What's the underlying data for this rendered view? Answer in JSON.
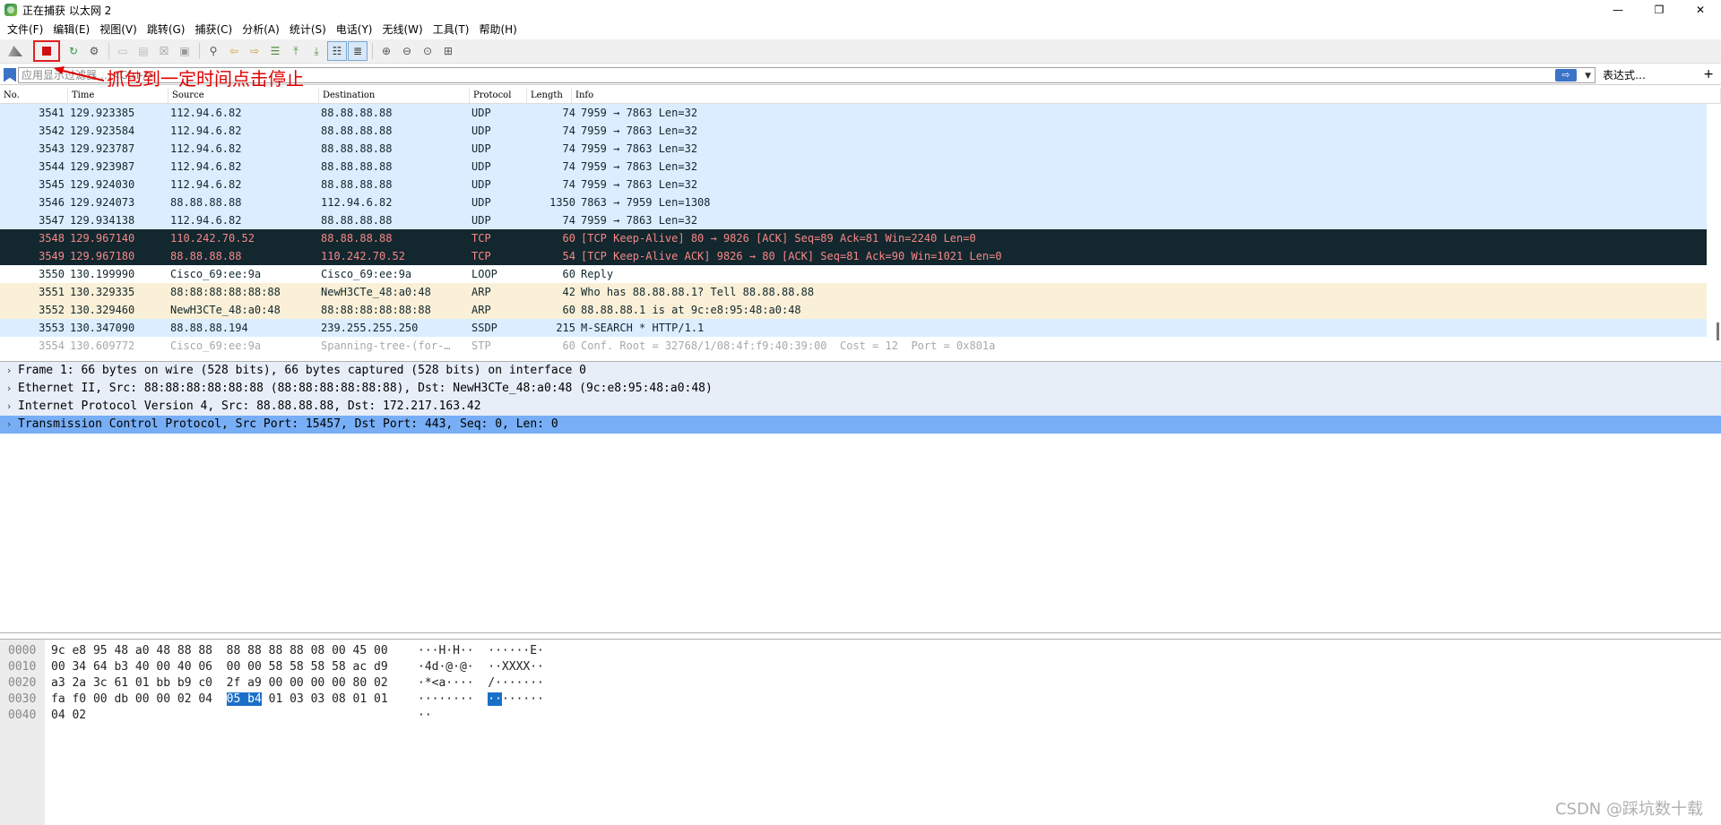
{
  "window": {
    "title": "正在捕获 以太网 2",
    "minimize": "—",
    "restore": "❐",
    "close": "✕"
  },
  "menu": [
    "文件(F)",
    "编辑(E)",
    "视图(V)",
    "跳转(G)",
    "捕获(C)",
    "分析(A)",
    "统计(S)",
    "电话(Y)",
    "无线(W)",
    "工具(T)",
    "帮助(H)"
  ],
  "annotation": {
    "text": "抓包到一定时间点击停止",
    "color": "#e00000"
  },
  "filter": {
    "placeholder": "应用显示过滤器 …<Ctrl-/>",
    "expression_label": "表达式…",
    "apply_icon": "⇨",
    "plus": "+"
  },
  "packet_list": {
    "columns": [
      "No.",
      "Time",
      "Source",
      "Destination",
      "Protocol",
      "Length",
      "Info"
    ],
    "rows": [
      {
        "no": "3541",
        "time": "129.923385",
        "src": "112.94.6.82",
        "dst": "88.88.88.88",
        "proto": "UDP",
        "len": "74",
        "info": "7959 → 7863 Len=32",
        "style": "bg-udp"
      },
      {
        "no": "3542",
        "time": "129.923584",
        "src": "112.94.6.82",
        "dst": "88.88.88.88",
        "proto": "UDP",
        "len": "74",
        "info": "7959 → 7863 Len=32",
        "style": "bg-udp"
      },
      {
        "no": "3543",
        "time": "129.923787",
        "src": "112.94.6.82",
        "dst": "88.88.88.88",
        "proto": "UDP",
        "len": "74",
        "info": "7959 → 7863 Len=32",
        "style": "bg-udp"
      },
      {
        "no": "3544",
        "time": "129.923987",
        "src": "112.94.6.82",
        "dst": "88.88.88.88",
        "proto": "UDP",
        "len": "74",
        "info": "7959 → 7863 Len=32",
        "style": "bg-udp"
      },
      {
        "no": "3545",
        "time": "129.924030",
        "src": "112.94.6.82",
        "dst": "88.88.88.88",
        "proto": "UDP",
        "len": "74",
        "info": "7959 → 7863 Len=32",
        "style": "bg-udp"
      },
      {
        "no": "3546",
        "time": "129.924073",
        "src": "88.88.88.88",
        "dst": "112.94.6.82",
        "proto": "UDP",
        "len": "1350",
        "info": "7863 → 7959 Len=1308",
        "style": "bg-udp"
      },
      {
        "no": "3547",
        "time": "129.934138",
        "src": "112.94.6.82",
        "dst": "88.88.88.88",
        "proto": "UDP",
        "len": "74",
        "info": "7959 → 7863 Len=32",
        "style": "bg-udp"
      },
      {
        "no": "3548",
        "time": "129.967140",
        "src": "110.242.70.52",
        "dst": "88.88.88.88",
        "proto": "TCP",
        "len": "60",
        "info": "[TCP Keep-Alive] 80 → 9826 [ACK] Seq=89 Ack=81 Win=2240 Len=0",
        "style": "bg-tcperr"
      },
      {
        "no": "3549",
        "time": "129.967180",
        "src": "88.88.88.88",
        "dst": "110.242.70.52",
        "proto": "TCP",
        "len": "54",
        "info": "[TCP Keep-Alive ACK] 9826 → 80 [ACK] Seq=81 Ack=90 Win=1021 Len=0",
        "style": "bg-tcperr"
      },
      {
        "no": "3550",
        "time": "130.199990",
        "src": "Cisco_69:ee:9a",
        "dst": "Cisco_69:ee:9a",
        "proto": "LOOP",
        "len": "60",
        "info": "Reply",
        "style": "bg-white"
      },
      {
        "no": "3551",
        "time": "130.329335",
        "src": "88:88:88:88:88:88",
        "dst": "NewH3CTe_48:a0:48",
        "proto": "ARP",
        "len": "42",
        "info": "Who has 88.88.88.1? Tell 88.88.88.88",
        "style": "bg-arp"
      },
      {
        "no": "3552",
        "time": "130.329460",
        "src": "NewH3CTe_48:a0:48",
        "dst": "88:88:88:88:88:88",
        "proto": "ARP",
        "len": "60",
        "info": "88.88.88.1 is at 9c:e8:95:48:a0:48",
        "style": "bg-arp"
      },
      {
        "no": "3553",
        "time": "130.347090",
        "src": "88.88.88.194",
        "dst": "239.255.255.250",
        "proto": "SSDP",
        "len": "215",
        "info": "M-SEARCH * HTTP/1.1",
        "style": "bg-ssdp"
      },
      {
        "no": "3554",
        "time": "130.609772",
        "src": "Cisco_69:ee:9a",
        "dst": "Spanning-tree-(for-…",
        "proto": "STP",
        "len": "60",
        "info": "Conf. Root = 32768/1/08:4f:f9:40:39:00  Cost = 12  Port = 0x801a",
        "style": "bg-stp"
      }
    ]
  },
  "details": [
    {
      "text": "Frame 1: 66 bytes on wire (528 bits), 66 bytes captured (528 bits) on interface 0",
      "selected": false
    },
    {
      "text": "Ethernet II, Src: 88:88:88:88:88:88 (88:88:88:88:88:88), Dst: NewH3CTe_48:a0:48 (9c:e8:95:48:a0:48)",
      "selected": false
    },
    {
      "text": "Internet Protocol Version 4, Src: 88.88.88.88, Dst: 172.217.163.42",
      "selected": false
    },
    {
      "text": "Transmission Control Protocol, Src Port: 15457, Dst Port: 443, Seq: 0, Len: 0",
      "selected": true
    }
  ],
  "bytes": [
    {
      "offset": "0000",
      "hex": "9c e8 95 48 a0 48 88 88  88 88 88 88 08 00 45 00",
      "ascii": "···H·H··  ······E·"
    },
    {
      "offset": "0010",
      "hex": "00 34 64 b3 40 00 40 06  00 00 58 58 58 58 ac d9",
      "ascii": "·4d·@·@·  ··XXXX··"
    },
    {
      "offset": "0020",
      "hex": "a3 2a 3c 61 01 bb b9 c0  2f a9 00 00 00 00 80 02",
      "ascii": "·*<a····  /·······"
    },
    {
      "offset": "0030",
      "hex_pre": "fa f0 00 db 00 00 02 04  ",
      "hex_hl": "05 b4",
      "hex_post": " 01 03 03 08 01 01",
      "ascii_pre": "········  ",
      "ascii_hl": "··",
      "ascii_post": "······"
    },
    {
      "offset": "0040",
      "hex": "04 02",
      "ascii": "··"
    }
  ],
  "watermark": "CSDN @踩坑数十载"
}
